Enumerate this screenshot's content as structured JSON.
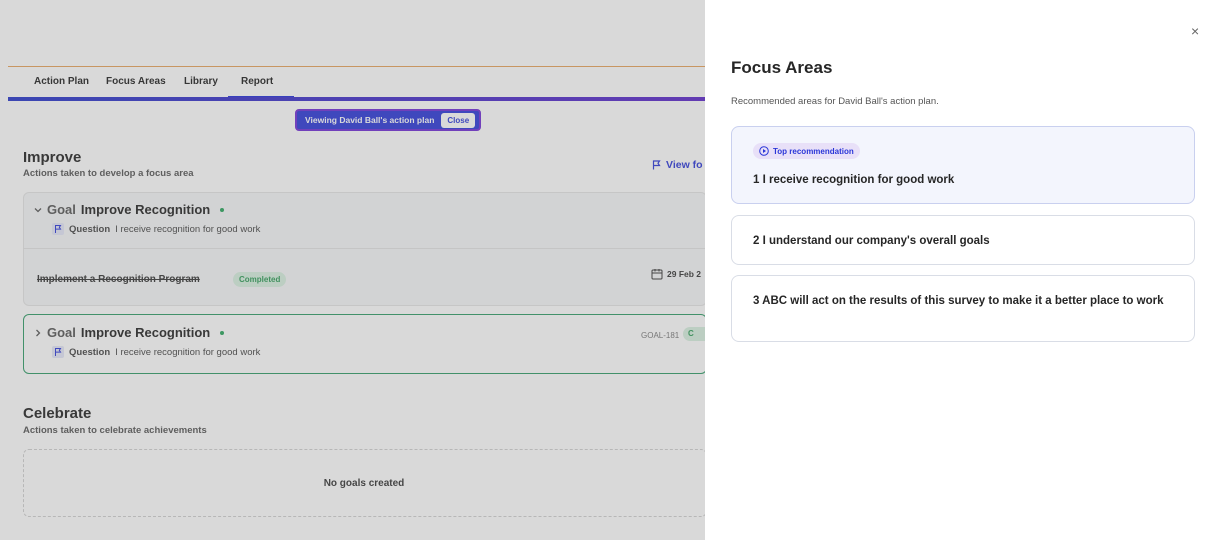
{
  "tabs": [
    "Action Plan",
    "Focus Areas",
    "Library",
    "Report"
  ],
  "banner": {
    "text": "Viewing David Ball's action plan",
    "close_label": "Close"
  },
  "improve": {
    "title": "Improve",
    "subtitle": "Actions taken to develop a focus area",
    "view_link": "View fo"
  },
  "goal1": {
    "goal_word": "Goal",
    "name": "Improve Recognition",
    "question_word": "Question",
    "question": "I receive recognition for good work",
    "action": "Implement a Recognition Program",
    "status": "Completed",
    "date": "29 Feb 2"
  },
  "goal2": {
    "goal_word": "Goal",
    "name": "Improve Recognition",
    "question_word": "Question",
    "question": "I receive recognition for good work",
    "goal_id": "GOAL-181",
    "badge": "C"
  },
  "celebrate": {
    "title": "Celebrate",
    "subtitle": "Actions taken to celebrate achievements",
    "empty": "No goals created"
  },
  "drawer": {
    "title": "Focus Areas",
    "subtitle": "Recommended areas for David Ball's action plan.",
    "close_icon": "×",
    "top_badge": "Top recommendation",
    "items": [
      "1  I receive recognition for good work",
      "2  I understand our company's overall goals",
      "3  ABC will act on the results of this survey to make it a better place to work"
    ]
  },
  "colors": {
    "accent": "#2a36d8",
    "success": "#2e9c57",
    "border": "#d9dde6"
  }
}
